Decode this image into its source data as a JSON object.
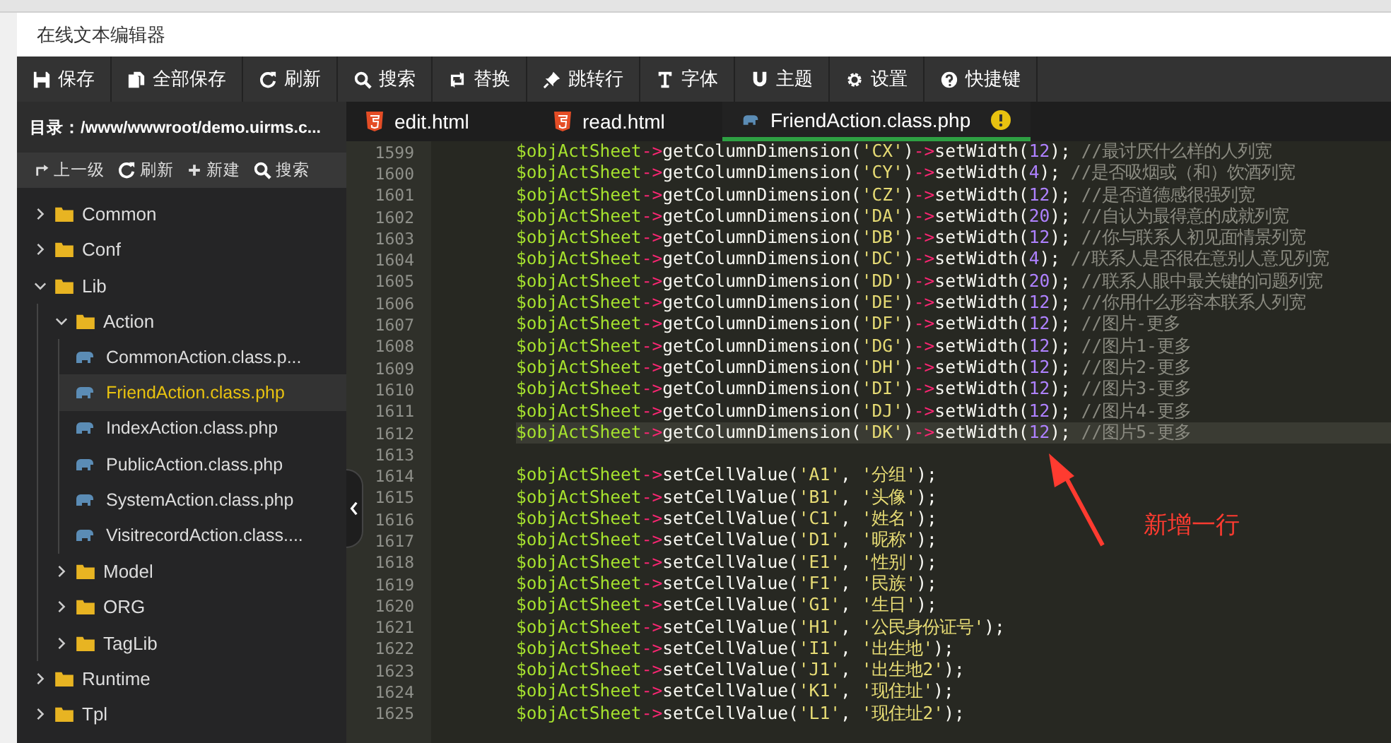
{
  "window": {
    "title": "在线文本编辑器"
  },
  "toolbar": [
    "保存",
    "全部保存",
    "刷新",
    "搜索",
    "替换",
    "跳转行",
    "字体",
    "主题",
    "设置",
    "快捷键"
  ],
  "sidebar": {
    "path": "目录：/www/wwwroot/demo.uirms.c...",
    "actions": [
      "上一级",
      "刷新",
      "新建",
      "搜索"
    ],
    "tree": [
      {
        "kind": "folder",
        "label": "Common",
        "expanded": false
      },
      {
        "kind": "folder",
        "label": "Conf",
        "expanded": false
      },
      {
        "kind": "folder",
        "label": "Lib",
        "expanded": true,
        "children": [
          {
            "kind": "folder",
            "label": "Action",
            "expanded": true,
            "children": [
              {
                "kind": "php",
                "label": "CommonAction.class.p...",
                "selected": false
              },
              {
                "kind": "php",
                "label": "FriendAction.class.php",
                "selected": true
              },
              {
                "kind": "php",
                "label": "IndexAction.class.php",
                "selected": false
              },
              {
                "kind": "php",
                "label": "PublicAction.class.php",
                "selected": false
              },
              {
                "kind": "php",
                "label": "SystemAction.class.php",
                "selected": false
              },
              {
                "kind": "php",
                "label": "VisitrecordAction.class....",
                "selected": false
              }
            ]
          },
          {
            "kind": "folder",
            "label": "Model",
            "expanded": false
          },
          {
            "kind": "folder",
            "label": "ORG",
            "expanded": false
          },
          {
            "kind": "folder",
            "label": "TagLib",
            "expanded": false
          }
        ]
      },
      {
        "kind": "folder",
        "label": "Runtime",
        "expanded": false
      },
      {
        "kind": "folder",
        "label": "Tpl",
        "expanded": false
      }
    ]
  },
  "tabs": [
    {
      "kind": "html",
      "label": "edit.html",
      "selected": false,
      "modified": false
    },
    {
      "kind": "html",
      "label": "read.html",
      "selected": false,
      "modified": false
    },
    {
      "kind": "php",
      "label": "FriendAction.class.php",
      "selected": true,
      "modified": true
    }
  ],
  "editor": {
    "lines": [
      {
        "num": "1599",
        "highlighted": false,
        "tokens": [
          {
            "kind": "var",
            "text": "$objActSheet"
          },
          {
            "kind": "op",
            "text": "->"
          },
          {
            "kind": "fn",
            "text": "getColumnDimension("
          },
          {
            "kind": "str",
            "text": "'CX'"
          },
          {
            "kind": "fn",
            "text": ")"
          },
          {
            "kind": "op",
            "text": "->"
          },
          {
            "kind": "fn",
            "text": "setWidth("
          },
          {
            "kind": "num",
            "text": "12"
          },
          {
            "kind": "fn",
            "text": ");"
          },
          {
            "kind": "com",
            "text": " //最讨厌什么样的人列宽"
          }
        ]
      },
      {
        "num": "1600",
        "highlighted": false,
        "tokens": [
          {
            "kind": "var",
            "text": "$objActSheet"
          },
          {
            "kind": "op",
            "text": "->"
          },
          {
            "kind": "fn",
            "text": "getColumnDimension("
          },
          {
            "kind": "str",
            "text": "'CY'"
          },
          {
            "kind": "fn",
            "text": ")"
          },
          {
            "kind": "op",
            "text": "->"
          },
          {
            "kind": "fn",
            "text": "setWidth("
          },
          {
            "kind": "num",
            "text": "4"
          },
          {
            "kind": "fn",
            "text": ");"
          },
          {
            "kind": "com",
            "text": " //是否吸烟或（和）饮酒列宽"
          }
        ]
      },
      {
        "num": "1601",
        "highlighted": false,
        "tokens": [
          {
            "kind": "var",
            "text": "$objActSheet"
          },
          {
            "kind": "op",
            "text": "->"
          },
          {
            "kind": "fn",
            "text": "getColumnDimension("
          },
          {
            "kind": "str",
            "text": "'CZ'"
          },
          {
            "kind": "fn",
            "text": ")"
          },
          {
            "kind": "op",
            "text": "->"
          },
          {
            "kind": "fn",
            "text": "setWidth("
          },
          {
            "kind": "num",
            "text": "12"
          },
          {
            "kind": "fn",
            "text": ");"
          },
          {
            "kind": "com",
            "text": " //是否道德感很强列宽"
          }
        ]
      },
      {
        "num": "1602",
        "highlighted": false,
        "tokens": [
          {
            "kind": "var",
            "text": "$objActSheet"
          },
          {
            "kind": "op",
            "text": "->"
          },
          {
            "kind": "fn",
            "text": "getColumnDimension("
          },
          {
            "kind": "str",
            "text": "'DA'"
          },
          {
            "kind": "fn",
            "text": ")"
          },
          {
            "kind": "op",
            "text": "->"
          },
          {
            "kind": "fn",
            "text": "setWidth("
          },
          {
            "kind": "num",
            "text": "20"
          },
          {
            "kind": "fn",
            "text": ");"
          },
          {
            "kind": "com",
            "text": " //自认为最得意的成就列宽"
          }
        ]
      },
      {
        "num": "1603",
        "highlighted": false,
        "tokens": [
          {
            "kind": "var",
            "text": "$objActSheet"
          },
          {
            "kind": "op",
            "text": "->"
          },
          {
            "kind": "fn",
            "text": "getColumnDimension("
          },
          {
            "kind": "str",
            "text": "'DB'"
          },
          {
            "kind": "fn",
            "text": ")"
          },
          {
            "kind": "op",
            "text": "->"
          },
          {
            "kind": "fn",
            "text": "setWidth("
          },
          {
            "kind": "num",
            "text": "12"
          },
          {
            "kind": "fn",
            "text": ");"
          },
          {
            "kind": "com",
            "text": " //你与联系人初见面情景列宽"
          }
        ]
      },
      {
        "num": "1604",
        "highlighted": false,
        "tokens": [
          {
            "kind": "var",
            "text": "$objActSheet"
          },
          {
            "kind": "op",
            "text": "->"
          },
          {
            "kind": "fn",
            "text": "getColumnDimension("
          },
          {
            "kind": "str",
            "text": "'DC'"
          },
          {
            "kind": "fn",
            "text": ")"
          },
          {
            "kind": "op",
            "text": "->"
          },
          {
            "kind": "fn",
            "text": "setWidth("
          },
          {
            "kind": "num",
            "text": "4"
          },
          {
            "kind": "fn",
            "text": ");"
          },
          {
            "kind": "com",
            "text": " //联系人是否很在意别人意见列宽"
          }
        ]
      },
      {
        "num": "1605",
        "highlighted": false,
        "tokens": [
          {
            "kind": "var",
            "text": "$objActSheet"
          },
          {
            "kind": "op",
            "text": "->"
          },
          {
            "kind": "fn",
            "text": "getColumnDimension("
          },
          {
            "kind": "str",
            "text": "'DD'"
          },
          {
            "kind": "fn",
            "text": ")"
          },
          {
            "kind": "op",
            "text": "->"
          },
          {
            "kind": "fn",
            "text": "setWidth("
          },
          {
            "kind": "num",
            "text": "20"
          },
          {
            "kind": "fn",
            "text": ");"
          },
          {
            "kind": "com",
            "text": " //联系人眼中最关键的问题列宽"
          }
        ]
      },
      {
        "num": "1606",
        "highlighted": false,
        "tokens": [
          {
            "kind": "var",
            "text": "$objActSheet"
          },
          {
            "kind": "op",
            "text": "->"
          },
          {
            "kind": "fn",
            "text": "getColumnDimension("
          },
          {
            "kind": "str",
            "text": "'DE'"
          },
          {
            "kind": "fn",
            "text": ")"
          },
          {
            "kind": "op",
            "text": "->"
          },
          {
            "kind": "fn",
            "text": "setWidth("
          },
          {
            "kind": "num",
            "text": "12"
          },
          {
            "kind": "fn",
            "text": ");"
          },
          {
            "kind": "com",
            "text": " //你用什么形容本联系人列宽"
          }
        ]
      },
      {
        "num": "1607",
        "highlighted": false,
        "tokens": [
          {
            "kind": "var",
            "text": "$objActSheet"
          },
          {
            "kind": "op",
            "text": "->"
          },
          {
            "kind": "fn",
            "text": "getColumnDimension("
          },
          {
            "kind": "str",
            "text": "'DF'"
          },
          {
            "kind": "fn",
            "text": ")"
          },
          {
            "kind": "op",
            "text": "->"
          },
          {
            "kind": "fn",
            "text": "setWidth("
          },
          {
            "kind": "num",
            "text": "12"
          },
          {
            "kind": "fn",
            "text": ");"
          },
          {
            "kind": "com",
            "text": " //图片-更多"
          }
        ]
      },
      {
        "num": "1608",
        "highlighted": false,
        "tokens": [
          {
            "kind": "var",
            "text": "$objActSheet"
          },
          {
            "kind": "op",
            "text": "->"
          },
          {
            "kind": "fn",
            "text": "getColumnDimension("
          },
          {
            "kind": "str",
            "text": "'DG'"
          },
          {
            "kind": "fn",
            "text": ")"
          },
          {
            "kind": "op",
            "text": "->"
          },
          {
            "kind": "fn",
            "text": "setWidth("
          },
          {
            "kind": "num",
            "text": "12"
          },
          {
            "kind": "fn",
            "text": ");"
          },
          {
            "kind": "com",
            "text": " //图片1-更多"
          }
        ]
      },
      {
        "num": "1609",
        "highlighted": false,
        "tokens": [
          {
            "kind": "var",
            "text": "$objActSheet"
          },
          {
            "kind": "op",
            "text": "->"
          },
          {
            "kind": "fn",
            "text": "getColumnDimension("
          },
          {
            "kind": "str",
            "text": "'DH'"
          },
          {
            "kind": "fn",
            "text": ")"
          },
          {
            "kind": "op",
            "text": "->"
          },
          {
            "kind": "fn",
            "text": "setWidth("
          },
          {
            "kind": "num",
            "text": "12"
          },
          {
            "kind": "fn",
            "text": ");"
          },
          {
            "kind": "com",
            "text": " //图片2-更多"
          }
        ]
      },
      {
        "num": "1610",
        "highlighted": false,
        "tokens": [
          {
            "kind": "var",
            "text": "$objActSheet"
          },
          {
            "kind": "op",
            "text": "->"
          },
          {
            "kind": "fn",
            "text": "getColumnDimension("
          },
          {
            "kind": "str",
            "text": "'DI'"
          },
          {
            "kind": "fn",
            "text": ")"
          },
          {
            "kind": "op",
            "text": "->"
          },
          {
            "kind": "fn",
            "text": "setWidth("
          },
          {
            "kind": "num",
            "text": "12"
          },
          {
            "kind": "fn",
            "text": ");"
          },
          {
            "kind": "com",
            "text": " //图片3-更多"
          }
        ]
      },
      {
        "num": "1611",
        "highlighted": false,
        "tokens": [
          {
            "kind": "var",
            "text": "$objActSheet"
          },
          {
            "kind": "op",
            "text": "->"
          },
          {
            "kind": "fn",
            "text": "getColumnDimension("
          },
          {
            "kind": "str",
            "text": "'DJ'"
          },
          {
            "kind": "fn",
            "text": ")"
          },
          {
            "kind": "op",
            "text": "->"
          },
          {
            "kind": "fn",
            "text": "setWidth("
          },
          {
            "kind": "num",
            "text": "12"
          },
          {
            "kind": "fn",
            "text": ");"
          },
          {
            "kind": "com",
            "text": " //图片4-更多"
          }
        ]
      },
      {
        "num": "1612",
        "highlighted": true,
        "tokens": [
          {
            "kind": "var",
            "text": "$objActSheet"
          },
          {
            "kind": "op",
            "text": "->"
          },
          {
            "kind": "fn",
            "text": "getColumnDimension("
          },
          {
            "kind": "str",
            "text": "'DK'"
          },
          {
            "kind": "fn",
            "text": ")"
          },
          {
            "kind": "op",
            "text": "->"
          },
          {
            "kind": "fn",
            "text": "setWidth("
          },
          {
            "kind": "num",
            "text": "12"
          },
          {
            "kind": "fn",
            "text": ");"
          },
          {
            "kind": "com",
            "text": " //图片5-更多"
          }
        ]
      },
      {
        "num": "1613"
      },
      {
        "num": "1614",
        "highlighted": false,
        "tokens": [
          {
            "kind": "var",
            "text": "$objActSheet"
          },
          {
            "kind": "op",
            "text": "->"
          },
          {
            "kind": "fn",
            "text": "setCellValue("
          },
          {
            "kind": "str",
            "text": "'A1'"
          },
          {
            "kind": "fn",
            "text": ", "
          },
          {
            "kind": "str",
            "text": "'分组'"
          },
          {
            "kind": "fn",
            "text": ");"
          }
        ]
      },
      {
        "num": "1615",
        "highlighted": false,
        "tokens": [
          {
            "kind": "var",
            "text": "$objActSheet"
          },
          {
            "kind": "op",
            "text": "->"
          },
          {
            "kind": "fn",
            "text": "setCellValue("
          },
          {
            "kind": "str",
            "text": "'B1'"
          },
          {
            "kind": "fn",
            "text": ", "
          },
          {
            "kind": "str",
            "text": "'头像'"
          },
          {
            "kind": "fn",
            "text": ");"
          }
        ]
      },
      {
        "num": "1616",
        "highlighted": false,
        "tokens": [
          {
            "kind": "var",
            "text": "$objActSheet"
          },
          {
            "kind": "op",
            "text": "->"
          },
          {
            "kind": "fn",
            "text": "setCellValue("
          },
          {
            "kind": "str",
            "text": "'C1'"
          },
          {
            "kind": "fn",
            "text": ", "
          },
          {
            "kind": "str",
            "text": "'姓名'"
          },
          {
            "kind": "fn",
            "text": ");"
          }
        ]
      },
      {
        "num": "1617",
        "highlighted": false,
        "tokens": [
          {
            "kind": "var",
            "text": "$objActSheet"
          },
          {
            "kind": "op",
            "text": "->"
          },
          {
            "kind": "fn",
            "text": "setCellValue("
          },
          {
            "kind": "str",
            "text": "'D1'"
          },
          {
            "kind": "fn",
            "text": ", "
          },
          {
            "kind": "str",
            "text": "'昵称'"
          },
          {
            "kind": "fn",
            "text": ");"
          }
        ]
      },
      {
        "num": "1618",
        "highlighted": false,
        "tokens": [
          {
            "kind": "var",
            "text": "$objActSheet"
          },
          {
            "kind": "op",
            "text": "->"
          },
          {
            "kind": "fn",
            "text": "setCellValue("
          },
          {
            "kind": "str",
            "text": "'E1'"
          },
          {
            "kind": "fn",
            "text": ", "
          },
          {
            "kind": "str",
            "text": "'性别'"
          },
          {
            "kind": "fn",
            "text": ");"
          }
        ]
      },
      {
        "num": "1619",
        "highlighted": false,
        "tokens": [
          {
            "kind": "var",
            "text": "$objActSheet"
          },
          {
            "kind": "op",
            "text": "->"
          },
          {
            "kind": "fn",
            "text": "setCellValue("
          },
          {
            "kind": "str",
            "text": "'F1'"
          },
          {
            "kind": "fn",
            "text": ", "
          },
          {
            "kind": "str",
            "text": "'民族'"
          },
          {
            "kind": "fn",
            "text": ");"
          }
        ]
      },
      {
        "num": "1620",
        "highlighted": false,
        "tokens": [
          {
            "kind": "var",
            "text": "$objActSheet"
          },
          {
            "kind": "op",
            "text": "->"
          },
          {
            "kind": "fn",
            "text": "setCellValue("
          },
          {
            "kind": "str",
            "text": "'G1'"
          },
          {
            "kind": "fn",
            "text": ", "
          },
          {
            "kind": "str",
            "text": "'生日'"
          },
          {
            "kind": "fn",
            "text": ");"
          }
        ]
      },
      {
        "num": "1621",
        "highlighted": false,
        "tokens": [
          {
            "kind": "var",
            "text": "$objActSheet"
          },
          {
            "kind": "op",
            "text": "->"
          },
          {
            "kind": "fn",
            "text": "setCellValue("
          },
          {
            "kind": "str",
            "text": "'H1'"
          },
          {
            "kind": "fn",
            "text": ", "
          },
          {
            "kind": "str",
            "text": "'公民身份证号'"
          },
          {
            "kind": "fn",
            "text": ");"
          }
        ]
      },
      {
        "num": "1622",
        "highlighted": false,
        "tokens": [
          {
            "kind": "var",
            "text": "$objActSheet"
          },
          {
            "kind": "op",
            "text": "->"
          },
          {
            "kind": "fn",
            "text": "setCellValue("
          },
          {
            "kind": "str",
            "text": "'I1'"
          },
          {
            "kind": "fn",
            "text": ", "
          },
          {
            "kind": "str",
            "text": "'出生地'"
          },
          {
            "kind": "fn",
            "text": ");"
          }
        ]
      },
      {
        "num": "1623",
        "highlighted": false,
        "tokens": [
          {
            "kind": "var",
            "text": "$objActSheet"
          },
          {
            "kind": "op",
            "text": "->"
          },
          {
            "kind": "fn",
            "text": "setCellValue("
          },
          {
            "kind": "str",
            "text": "'J1'"
          },
          {
            "kind": "fn",
            "text": ", "
          },
          {
            "kind": "str",
            "text": "'出生地2'"
          },
          {
            "kind": "fn",
            "text": ");"
          }
        ]
      },
      {
        "num": "1624",
        "highlighted": false,
        "tokens": [
          {
            "kind": "var",
            "text": "$objActSheet"
          },
          {
            "kind": "op",
            "text": "->"
          },
          {
            "kind": "fn",
            "text": "setCellValue("
          },
          {
            "kind": "str",
            "text": "'K1'"
          },
          {
            "kind": "fn",
            "text": ", "
          },
          {
            "kind": "str",
            "text": "'现住址'"
          },
          {
            "kind": "fn",
            "text": ");"
          }
        ]
      },
      {
        "num": "1625",
        "highlighted": false,
        "tokens": [
          {
            "kind": "var",
            "text": "$objActSheet"
          },
          {
            "kind": "op",
            "text": "->"
          },
          {
            "kind": "fn",
            "text": "setCellValue("
          },
          {
            "kind": "str",
            "text": "'L1'"
          },
          {
            "kind": "fn",
            "text": ", "
          },
          {
            "kind": "str",
            "text": "'现住址2'"
          },
          {
            "kind": "fn",
            "text": ");"
          }
        ]
      }
    ]
  },
  "annotation": {
    "label": "新增一行"
  }
}
